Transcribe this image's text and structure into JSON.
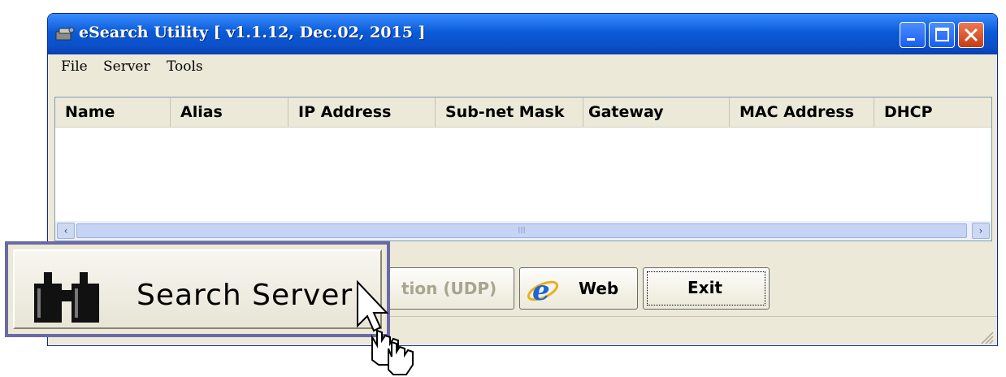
{
  "window": {
    "title": "eSearch Utility [ v1.1.12, Dec.02, 2015 ]"
  },
  "menu": {
    "file": "File",
    "server": "Server",
    "tools": "Tools"
  },
  "table": {
    "columns": [
      "Name",
      "Alias",
      "IP Address",
      "Sub-net Mask",
      "Gateway",
      "MAC Address",
      "DHCP"
    ],
    "rows": []
  },
  "scrollbar": {
    "left_arrow": "‹",
    "right_arrow": "›",
    "thumb_grip": "III"
  },
  "buttons": {
    "search_server": "Search Server",
    "configuration_partial": "tion (UDP)",
    "web": "Web",
    "exit": "Exit"
  },
  "icons": {
    "title": "search-utility-icon",
    "binoculars": "binoculars-icon",
    "web": "ie-browser-icon",
    "cursor": "hand-pointer-cursor"
  }
}
